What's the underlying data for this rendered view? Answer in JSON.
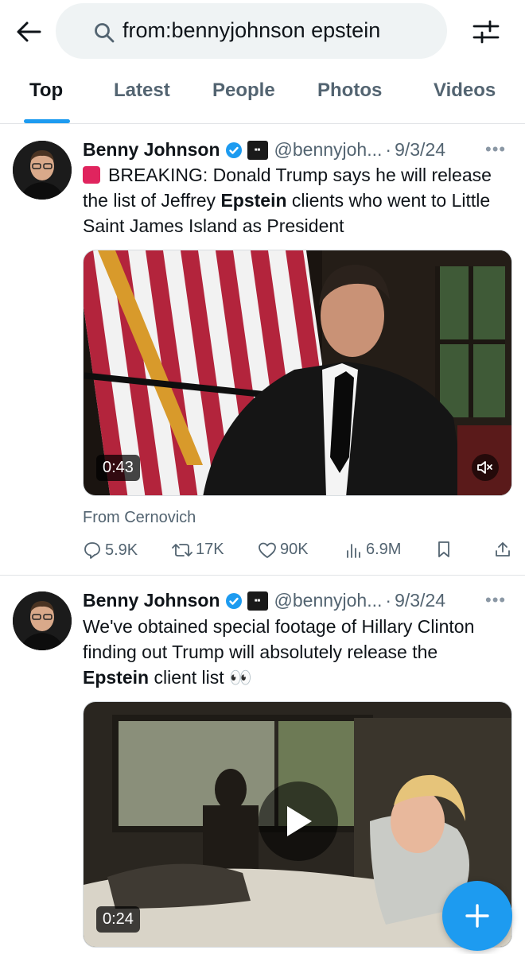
{
  "search": {
    "query": "from:bennyjohnson epstein"
  },
  "tabs": [
    {
      "label": "Top"
    },
    {
      "label": "Latest"
    },
    {
      "label": "People"
    },
    {
      "label": "Photos"
    },
    {
      "label": "Videos"
    }
  ],
  "tweets": [
    {
      "name": "Benny Johnson",
      "handle": "@bennyjoh...",
      "date": "9/3/24",
      "text_pre": "BREAKING: Donald Trump says he will release the list of Jeffrey ",
      "text_bold": "Epstein",
      "text_post": " clients who went to Little Saint James Island as President",
      "video_duration": "0:43",
      "from_text": "From Cernovich",
      "replies": "5.9K",
      "reposts": "17K",
      "likes": "90K",
      "views": "6.9M"
    },
    {
      "name": "Benny Johnson",
      "handle": "@bennyjoh...",
      "date": "9/3/24",
      "text_pre": "We've obtained special footage of Hillary Clinton finding out Trump will absolutely release the ",
      "text_bold": "Epstein",
      "text_post": " client list 👀",
      "video_duration": "0:24"
    }
  ],
  "colors": {
    "accent": "#1d9bf0",
    "secondary_text": "#536471",
    "verified": "#1d9bf0",
    "breaking_emoji": "#e0245e"
  },
  "icons": [
    "back-arrow-icon",
    "search-icon",
    "filter-sliders-icon",
    "verified-badge-icon",
    "more-icon",
    "mute-icon",
    "reply-icon",
    "repost-icon",
    "like-icon",
    "views-icon",
    "bookmark-icon",
    "share-icon",
    "play-icon",
    "compose-plus-icon"
  ]
}
